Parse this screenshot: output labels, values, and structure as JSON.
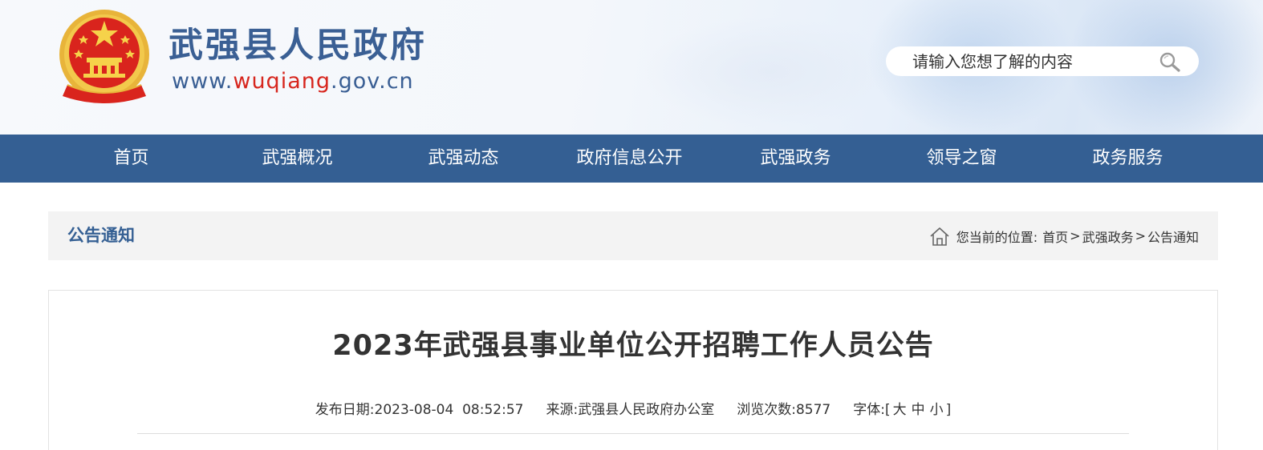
{
  "header": {
    "site_name": "武强县人民政府",
    "url_prefix": "www.",
    "url_domain": "wuqiang",
    "url_suffix": ".gov.cn",
    "search_placeholder": "请输入您想了解的内容",
    "emblem_icon": "national-emblem-icon",
    "search_icon": "magnifier-icon"
  },
  "nav": {
    "items": [
      "首页",
      "武强概况",
      "武强动态",
      "政府信息公开",
      "武强政务",
      "领导之窗",
      "政务服务"
    ]
  },
  "breadcrumb": {
    "section_title": "公告通知",
    "location_label": "您当前的位置:",
    "home_icon": "home-icon",
    "path": [
      "首页",
      "武强政务",
      "公告通知"
    ],
    "separator": ">"
  },
  "article": {
    "title": "2023年武强县事业单位公开招聘工作人员公告",
    "publish_label": "发布日期:",
    "publish_date": "2023-08-04",
    "publish_time": "08:52:57",
    "source_label": "来源:",
    "source": "武强县人民政府办公室",
    "views_label": "浏览次数:",
    "views": "8577",
    "font_label": "字体:",
    "font_open": "[",
    "font_large": "大",
    "font_medium": "中",
    "font_small": "小",
    "font_close": "]"
  },
  "colors": {
    "brand_blue": "#345f93",
    "url_red": "#d7261e",
    "crumb_bg": "#f3f3f3"
  }
}
